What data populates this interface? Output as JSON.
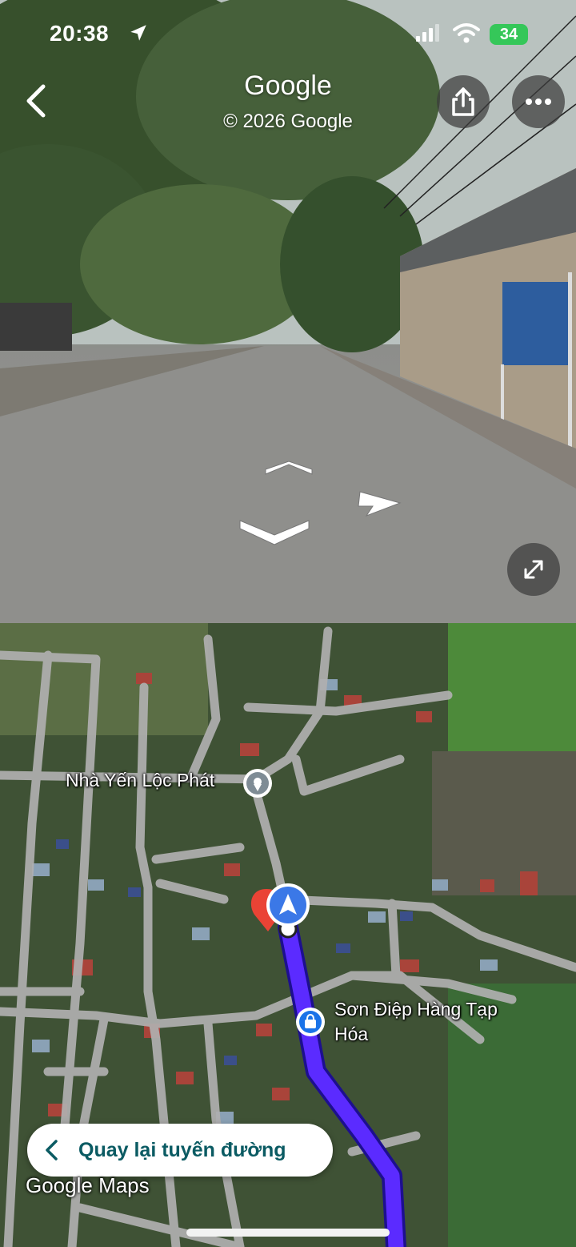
{
  "status_bar": {
    "time": "20:38",
    "battery": "34"
  },
  "street_view": {
    "title": "Google",
    "copyright": "© 2026 Google",
    "back_icon": "chevron-left-icon",
    "share_icon": "share-icon",
    "more_icon": "more-horizontal-icon",
    "expand_icon": "expand-icon",
    "navigation_arrows": [
      "forward",
      "backward",
      "right"
    ]
  },
  "map": {
    "places": [
      {
        "name": "Nhà Yến Lộc Phát",
        "icon": "place-pin-icon"
      },
      {
        "name": "Sơn Điệp Hàng Tạp Hóa",
        "icon": "shopping-bag-pin-icon"
      }
    ],
    "back_to_route_label": "Quay lại tuyến đường",
    "logo_text": "Google Maps",
    "colors": {
      "route": "#5b2bff",
      "user_marker": "#3b78e7",
      "destination_pin": "#ea4335",
      "road": "#b5b5b5"
    }
  }
}
